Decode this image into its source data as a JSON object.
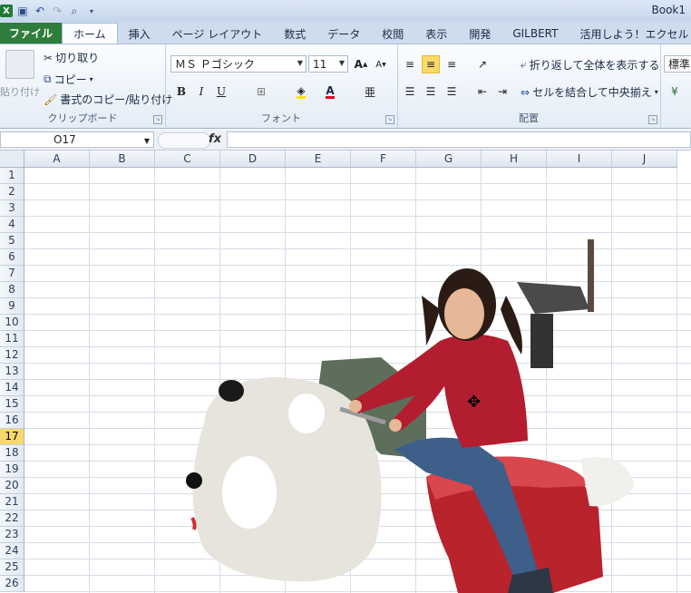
{
  "title_bar": {
    "book_title": "Book1"
  },
  "tabs": [
    {
      "label": "ファイル"
    },
    {
      "label": "ホーム"
    },
    {
      "label": "挿入"
    },
    {
      "label": "ページ レイアウト"
    },
    {
      "label": "数式"
    },
    {
      "label": "データ"
    },
    {
      "label": "校閲"
    },
    {
      "label": "表示"
    },
    {
      "label": "開発"
    },
    {
      "label": "GILBERT"
    },
    {
      "label": "活用しよう！エクセル"
    }
  ],
  "clipboard": {
    "paste": "貼り付け",
    "cut": "切り取り",
    "copy": "コピー",
    "format_painter": "書式のコピー/貼り付け",
    "group_label": "クリップボード"
  },
  "font": {
    "name": "ＭＳ Ｐゴシック",
    "size": "11",
    "grow": "A",
    "shrink": "A",
    "bold": "B",
    "italic": "I",
    "underline": "U",
    "font_color_glyph": "A",
    "group_label": "フォント"
  },
  "alignment": {
    "wrap_text": "折り返して全体を表示する",
    "merge_center": "セルを結合して中央揃え",
    "group_label": "配置"
  },
  "number": {
    "format": "標準"
  },
  "formula_bar": {
    "name_box": "O17",
    "fx": "fx",
    "formula": ""
  },
  "sheet": {
    "columns": [
      "A",
      "B",
      "C",
      "D",
      "E",
      "F",
      "G",
      "H",
      "I",
      "J"
    ],
    "rows": [
      "1",
      "2",
      "3",
      "4",
      "5",
      "6",
      "7",
      "8",
      "9",
      "10",
      "11",
      "12",
      "13",
      "14",
      "15",
      "16",
      "17",
      "18",
      "19",
      "20",
      "21",
      "22",
      "23",
      "24",
      "25",
      "26"
    ],
    "selected_row": "17"
  },
  "colors": {
    "file_tab": "#2f7d3c",
    "selected_row": "#f9d86a",
    "excel_green": "#1f7a36"
  }
}
